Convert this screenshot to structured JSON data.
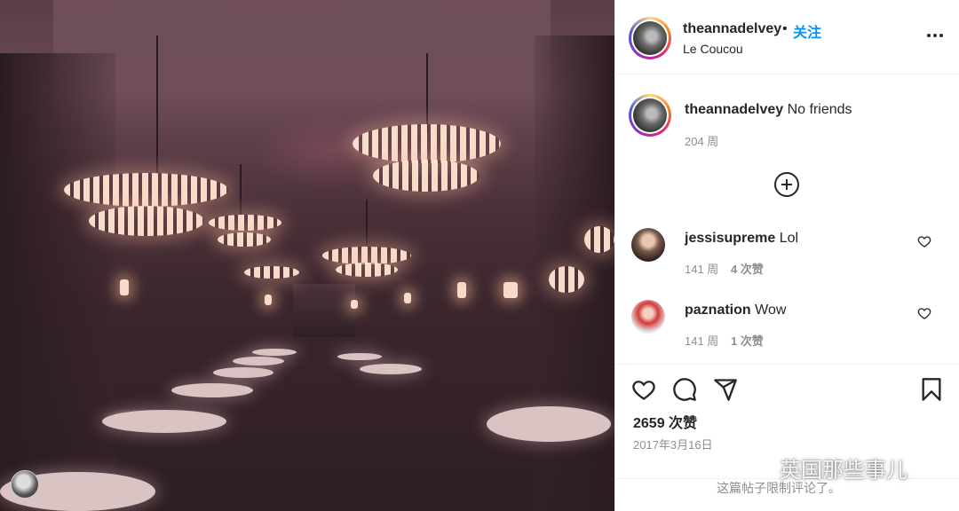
{
  "post": {
    "username": "theannadelvey",
    "separator": "•",
    "follow_label": "关注",
    "location": "Le Coucou",
    "more_icon": "more-horizontal-icon"
  },
  "caption": {
    "username": "theannadelvey",
    "text": "No friends",
    "time": "204 周"
  },
  "comments": [
    {
      "username": "jessisupreme",
      "text": "Lol",
      "time": "141 周",
      "likes": "4 次赞"
    },
    {
      "username": "paznation",
      "text": "Wow",
      "time": "141 周",
      "likes": "1 次赞"
    }
  ],
  "actions": {
    "icons": [
      "heart-icon",
      "comment-icon",
      "share-icon",
      "bookmark-icon"
    ],
    "likes_count": "2659 次赞",
    "date": "2017年3月16日",
    "comments_limited": "这篇帖子限制评论了。"
  },
  "watermark": {
    "text": "英国那些事儿"
  },
  "colors": {
    "accent": "#0095f6",
    "text": "#262626",
    "muted": "#8e8e8e",
    "border": "#efefef"
  }
}
